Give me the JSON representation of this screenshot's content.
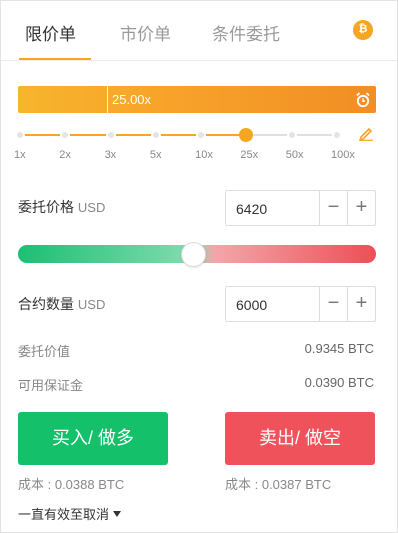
{
  "tabs": {
    "limit": "限价单",
    "market": "市价单",
    "conditional": "条件委托",
    "coin_icon": "bitcoin-icon",
    "coin_symbol": "₿"
  },
  "leverage": {
    "value": "25.00x",
    "ticks": [
      "1x",
      "2x",
      "3x",
      "5x",
      "10x",
      "25x",
      "50x",
      "100x"
    ],
    "selected_index": 5
  },
  "price": {
    "label": "委托价格",
    "unit": "USD",
    "value": "6420",
    "minus": "−",
    "plus": "+"
  },
  "amount": {
    "label": "合约数量",
    "unit": "USD",
    "value": "6000",
    "minus": "−",
    "plus": "+"
  },
  "order_value": {
    "label": "委托价值",
    "value": "0.9345 BTC"
  },
  "available_margin": {
    "label": "可用保证金",
    "value": "0.0390 BTC"
  },
  "buy": {
    "label": "买入/ 做多",
    "cost": "成本 : 0.0388 BTC"
  },
  "sell": {
    "label": "卖出/ 做空",
    "cost": "成本 : 0.0387 BTC"
  },
  "validity": {
    "label": "一直有效至取消"
  },
  "colors": {
    "accent": "#f5a623",
    "buy": "#15c06b",
    "sell": "#ef525b"
  }
}
